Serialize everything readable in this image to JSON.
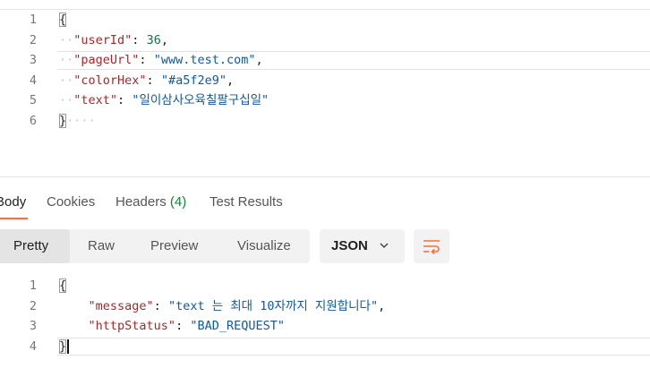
{
  "request_body": {
    "lines": [
      {
        "num": "1",
        "open_brace": "{"
      },
      {
        "num": "2",
        "key": "\"userId\"",
        "sep": ": ",
        "value": "36",
        "tail": ","
      },
      {
        "num": "3",
        "key": "\"pageUrl\"",
        "sep": ": ",
        "value": "\"www.test.com\"",
        "tail": ","
      },
      {
        "num": "4",
        "key": "\"colorHex\"",
        "sep": ": ",
        "value": "\"#a5f2e9\"",
        "tail": ","
      },
      {
        "num": "5",
        "key": "\"text\"",
        "sep": ": ",
        "value": "\"일이삼사오육칠팔구십일\"",
        "tail": ""
      },
      {
        "num": "6",
        "close_brace": "}"
      }
    ]
  },
  "response_tabs": {
    "body": "Body",
    "cookies": "Cookies",
    "headers": "Headers",
    "headers_count": "(4)",
    "test_results": "Test Results"
  },
  "view_modes": {
    "pretty": "Pretty",
    "raw": "Raw",
    "preview": "Preview",
    "visualize": "Visualize",
    "format_select": "JSON",
    "wrap_icon": "wrap-lines-icon"
  },
  "response_body": {
    "lines": [
      {
        "num": "1",
        "open_brace": "{"
      },
      {
        "num": "2",
        "key": "\"message\"",
        "sep": ": ",
        "value": "\"text 는 최대 10자까지 지원합니다\"",
        "tail": ","
      },
      {
        "num": "3",
        "key": "\"httpStatus\"",
        "sep": ": ",
        "value": "\"BAD_REQUEST\"",
        "tail": ""
      },
      {
        "num": "4",
        "close_brace": "}"
      }
    ]
  },
  "colors": {
    "accent": "#ff6c37",
    "json_key": "#a5292a",
    "json_string": "#0f5aa0",
    "json_number": "#0b7a3a",
    "headers_count": "#0b8a36"
  }
}
